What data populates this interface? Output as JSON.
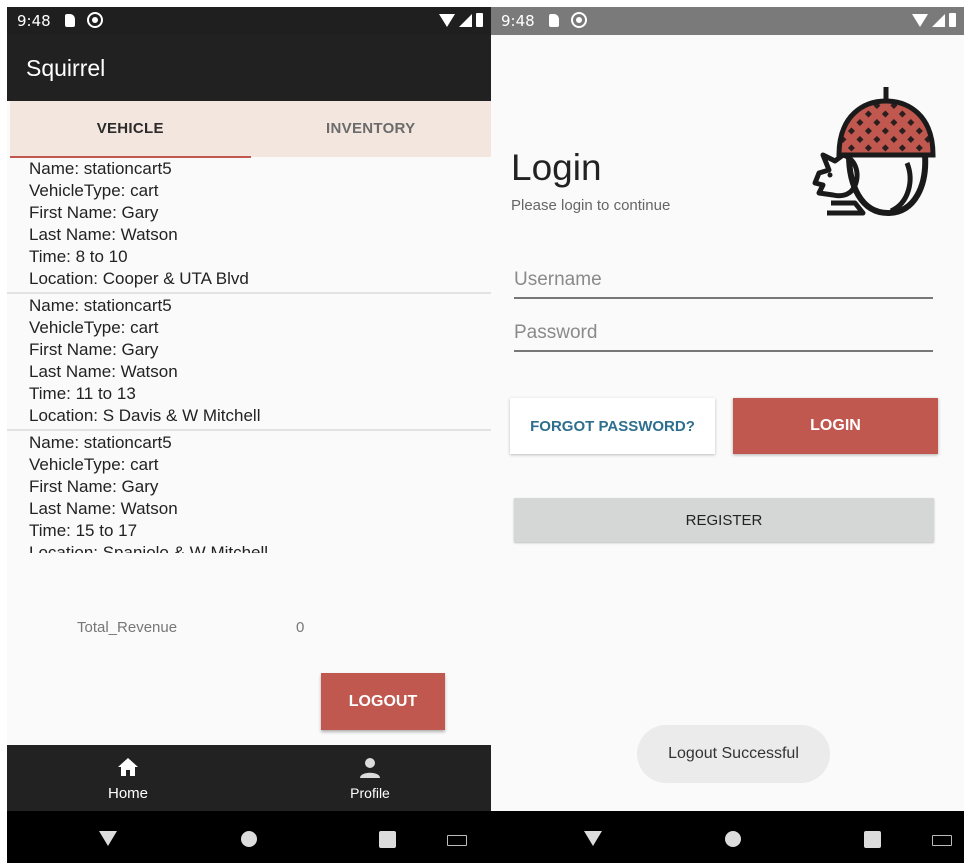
{
  "left_screen": {
    "status": {
      "time": "9:48"
    },
    "app_title": "Squirrel",
    "tabs": [
      {
        "label": "VEHICLE",
        "active": true
      },
      {
        "label": "INVENTORY",
        "active": false
      }
    ],
    "vehicles": [
      {
        "name": "Name: stationcart5",
        "type": "VehicleType: cart",
        "first": "First Name: Gary",
        "last": "Last Name: Watson",
        "time": "Time: 8 to 10",
        "location": "Location: Cooper & UTA Blvd"
      },
      {
        "name": "Name: stationcart5",
        "type": "VehicleType: cart",
        "first": "First Name: Gary",
        "last": "Last Name: Watson",
        "time": "Time: 11 to 13",
        "location": "Location: S Davis & W Mitchell"
      },
      {
        "name": "Name: stationcart5",
        "type": "VehicleType: cart",
        "first": "First Name: Gary",
        "last": "Last Name: Watson",
        "time": "Time: 15 to 17",
        "location": "Location: Spaniolo & W Mitchell"
      }
    ],
    "revenue": {
      "label": "Total_Revenue",
      "value": "0"
    },
    "logout_label": "LOGOUT",
    "bottom_nav": [
      {
        "label": "Home",
        "icon": "home-icon"
      },
      {
        "label": "Profile",
        "icon": "person-icon"
      }
    ]
  },
  "right_screen": {
    "status": {
      "time": "9:48"
    },
    "title": "Login",
    "subtitle": "Please login to continue",
    "username_placeholder": "Username",
    "password_placeholder": "Password",
    "forgot_label": "FORGOT PASSWORD?",
    "login_label": "LOGIN",
    "register_label": "REGISTER",
    "toast": "Logout Successful"
  },
  "colors": {
    "accent": "#c0584f",
    "dark": "#212121",
    "tab_bg": "#f3e6de",
    "link": "#2e6e8e"
  }
}
